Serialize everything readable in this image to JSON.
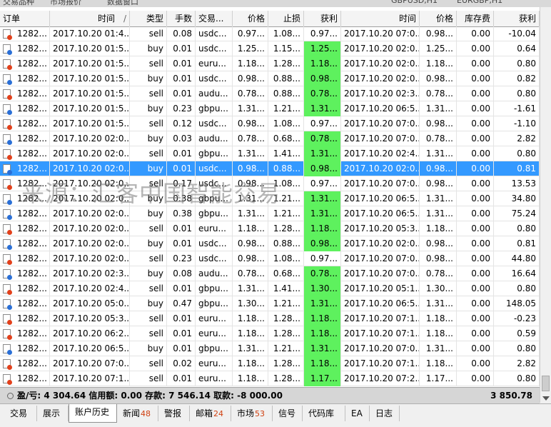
{
  "top_strip": {
    "titles": [
      "交易品种",
      "市场报价",
      "数据窗口",
      "GBPUSD,H1",
      "EURGBP,H1"
    ]
  },
  "headers": [
    "订单",
    "时间",
    "类型",
    "手数",
    "交易...",
    "价格",
    "止损",
    "获利",
    "时间",
    "价格",
    "库存费",
    "获利"
  ],
  "sort_indicator": "/",
  "rows": [
    {
      "order": "1282...",
      "open_time": "2017.10.20 01:4...",
      "type": "sell",
      "lots": "0.08",
      "symbol": "usdc...",
      "price": "0.97...",
      "sl": "1.08...",
      "tp": "0.97...",
      "tp_hit": false,
      "close_time": "2017.10.20 07:0...",
      "close_price": "0.98...",
      "swap": "0.00",
      "profit": "-10.04"
    },
    {
      "order": "1282...",
      "open_time": "2017.10.20 01:5...",
      "type": "buy",
      "lots": "0.01",
      "symbol": "usdc...",
      "price": "1.25...",
      "sl": "1.15...",
      "tp": "1.25...",
      "tp_hit": true,
      "close_time": "2017.10.20 02:0...",
      "close_price": "1.25...",
      "swap": "0.00",
      "profit": "0.64"
    },
    {
      "order": "1282...",
      "open_time": "2017.10.20 01:5...",
      "type": "sell",
      "lots": "0.01",
      "symbol": "euru...",
      "price": "1.18...",
      "sl": "1.28...",
      "tp": "1.18...",
      "tp_hit": true,
      "close_time": "2017.10.20 02:0...",
      "close_price": "1.18...",
      "swap": "0.00",
      "profit": "0.80"
    },
    {
      "order": "1282...",
      "open_time": "2017.10.20 01:5...",
      "type": "buy",
      "lots": "0.01",
      "symbol": "usdc...",
      "price": "0.98...",
      "sl": "0.88...",
      "tp": "0.98...",
      "tp_hit": true,
      "close_time": "2017.10.20 02:0...",
      "close_price": "0.98...",
      "swap": "0.00",
      "profit": "0.82"
    },
    {
      "order": "1282...",
      "open_time": "2017.10.20 01:5...",
      "type": "sell",
      "lots": "0.01",
      "symbol": "audu...",
      "price": "0.78...",
      "sl": "0.88...",
      "tp": "0.78...",
      "tp_hit": true,
      "close_time": "2017.10.20 02:3...",
      "close_price": "0.78...",
      "swap": "0.00",
      "profit": "0.80"
    },
    {
      "order": "1282...",
      "open_time": "2017.10.20 01:5...",
      "type": "buy",
      "lots": "0.23",
      "symbol": "gbpu...",
      "price": "1.31...",
      "sl": "1.21...",
      "tp": "1.31...",
      "tp_hit": true,
      "close_time": "2017.10.20 06:5...",
      "close_price": "1.31...",
      "swap": "0.00",
      "profit": "-1.61"
    },
    {
      "order": "1282...",
      "open_time": "2017.10.20 01:5...",
      "type": "sell",
      "lots": "0.12",
      "symbol": "usdc...",
      "price": "0.98...",
      "sl": "1.08...",
      "tp": "0.97...",
      "tp_hit": false,
      "close_time": "2017.10.20 07:0...",
      "close_price": "0.98...",
      "swap": "0.00",
      "profit": "-1.10"
    },
    {
      "order": "1282...",
      "open_time": "2017.10.20 02:0...",
      "type": "buy",
      "lots": "0.03",
      "symbol": "audu...",
      "price": "0.78...",
      "sl": "0.68...",
      "tp": "0.78...",
      "tp_hit": true,
      "close_time": "2017.10.20 07:0...",
      "close_price": "0.78...",
      "swap": "0.00",
      "profit": "2.82"
    },
    {
      "order": "1282...",
      "open_time": "2017.10.20 02:0...",
      "type": "sell",
      "lots": "0.01",
      "symbol": "gbpu...",
      "price": "1.31...",
      "sl": "1.41...",
      "tp": "1.31...",
      "tp_hit": true,
      "close_time": "2017.10.20 02:4...",
      "close_price": "1.31...",
      "swap": "0.00",
      "profit": "0.80"
    },
    {
      "order": "1282...",
      "open_time": "2017.10.20 02:0...",
      "type": "buy",
      "lots": "0.01",
      "symbol": "usdc...",
      "price": "0.98...",
      "sl": "0.88...",
      "tp": "0.98...",
      "tp_hit": true,
      "close_time": "2017.10.20 02:0...",
      "close_price": "0.98...",
      "swap": "0.00",
      "profit": "0.81",
      "selected": true
    },
    {
      "order": "1282...",
      "open_time": "2017.10.20 02:0...",
      "type": "sell",
      "lots": "0.17",
      "symbol": "usdc...",
      "price": "0.98...",
      "sl": "1.08...",
      "tp": "0.97...",
      "tp_hit": false,
      "close_time": "2017.10.20 07:0...",
      "close_price": "0.98...",
      "swap": "0.00",
      "profit": "13.53"
    },
    {
      "order": "1282...",
      "open_time": "2017.10.20 02:0...",
      "type": "buy",
      "lots": "0.38",
      "symbol": "gbpu...",
      "price": "1.31...",
      "sl": "1.21...",
      "tp": "1.31...",
      "tp_hit": true,
      "close_time": "2017.10.20 06:5...",
      "close_price": "1.31...",
      "swap": "0.00",
      "profit": "34.80"
    },
    {
      "order": "1282...",
      "open_time": "2017.10.20 02:0...",
      "type": "buy",
      "lots": "0.38",
      "symbol": "gbpu...",
      "price": "1.31...",
      "sl": "1.21...",
      "tp": "1.31...",
      "tp_hit": true,
      "close_time": "2017.10.20 06:5...",
      "close_price": "1.31...",
      "swap": "0.00",
      "profit": "75.24"
    },
    {
      "order": "1282...",
      "open_time": "2017.10.20 02:0...",
      "type": "sell",
      "lots": "0.01",
      "symbol": "euru...",
      "price": "1.18...",
      "sl": "1.28...",
      "tp": "1.18...",
      "tp_hit": true,
      "close_time": "2017.10.20 05:3...",
      "close_price": "1.18...",
      "swap": "0.00",
      "profit": "0.80"
    },
    {
      "order": "1282...",
      "open_time": "2017.10.20 02:0...",
      "type": "buy",
      "lots": "0.01",
      "symbol": "usdc...",
      "price": "0.98...",
      "sl": "0.88...",
      "tp": "0.98...",
      "tp_hit": true,
      "close_time": "2017.10.20 02:0...",
      "close_price": "0.98...",
      "swap": "0.00",
      "profit": "0.81"
    },
    {
      "order": "1282...",
      "open_time": "2017.10.20 02:0...",
      "type": "sell",
      "lots": "0.23",
      "symbol": "usdc...",
      "price": "0.98...",
      "sl": "1.08...",
      "tp": "0.97...",
      "tp_hit": false,
      "close_time": "2017.10.20 07:0...",
      "close_price": "0.98...",
      "swap": "0.00",
      "profit": "44.80"
    },
    {
      "order": "1282...",
      "open_time": "2017.10.20 02:3...",
      "type": "buy",
      "lots": "0.08",
      "symbol": "audu...",
      "price": "0.78...",
      "sl": "0.68...",
      "tp": "0.78...",
      "tp_hit": true,
      "close_time": "2017.10.20 07:0...",
      "close_price": "0.78...",
      "swap": "0.00",
      "profit": "16.64"
    },
    {
      "order": "1282...",
      "open_time": "2017.10.20 02:4...",
      "type": "sell",
      "lots": "0.01",
      "symbol": "gbpu...",
      "price": "1.31...",
      "sl": "1.41...",
      "tp": "1.30...",
      "tp_hit": true,
      "close_time": "2017.10.20 05:1...",
      "close_price": "1.30...",
      "swap": "0.00",
      "profit": "0.80"
    },
    {
      "order": "1282...",
      "open_time": "2017.10.20 05:0...",
      "type": "buy",
      "lots": "0.47",
      "symbol": "gbpu...",
      "price": "1.30...",
      "sl": "1.21...",
      "tp": "1.31...",
      "tp_hit": true,
      "close_time": "2017.10.20 06:5...",
      "close_price": "1.31...",
      "swap": "0.00",
      "profit": "148.05"
    },
    {
      "order": "1282...",
      "open_time": "2017.10.20 05:3...",
      "type": "sell",
      "lots": "0.01",
      "symbol": "euru...",
      "price": "1.18...",
      "sl": "1.28...",
      "tp": "1.18...",
      "tp_hit": true,
      "close_time": "2017.10.20 07:1...",
      "close_price": "1.18...",
      "swap": "0.00",
      "profit": "-0.23"
    },
    {
      "order": "1282...",
      "open_time": "2017.10.20 06:2...",
      "type": "sell",
      "lots": "0.01",
      "symbol": "euru...",
      "price": "1.18...",
      "sl": "1.28...",
      "tp": "1.18...",
      "tp_hit": true,
      "close_time": "2017.10.20 07:1...",
      "close_price": "1.18...",
      "swap": "0.00",
      "profit": "0.59"
    },
    {
      "order": "1282...",
      "open_time": "2017.10.20 06:5...",
      "type": "buy",
      "lots": "0.01",
      "symbol": "gbpu...",
      "price": "1.31...",
      "sl": "1.21...",
      "tp": "1.31...",
      "tp_hit": true,
      "close_time": "2017.10.20 07:0...",
      "close_price": "1.31...",
      "swap": "0.00",
      "profit": "0.80"
    },
    {
      "order": "1282...",
      "open_time": "2017.10.20 07:0...",
      "type": "sell",
      "lots": "0.02",
      "symbol": "euru...",
      "price": "1.18...",
      "sl": "1.28...",
      "tp": "1.18...",
      "tp_hit": true,
      "close_time": "2017.10.20 07:1...",
      "close_price": "1.18...",
      "swap": "0.00",
      "profit": "2.82"
    },
    {
      "order": "1282...",
      "open_time": "2017.10.20 07:1...",
      "type": "sell",
      "lots": "0.01",
      "symbol": "euru...",
      "price": "1.18...",
      "sl": "1.28...",
      "tp": "1.17...",
      "tp_hit": true,
      "close_time": "2017.10.20 07:2...",
      "close_price": "1.17...",
      "swap": "0.00",
      "profit": "0.80"
    }
  ],
  "watermark": "来源：汇客中国智能交易",
  "summary": {
    "text": "盈/亏: 4 304.64  信用额: 0.00  存款: 7 546.14  取款: -8 000.00",
    "total": "3 850.78"
  },
  "tabs": [
    {
      "label": "交易",
      "count": ""
    },
    {
      "label": "展示",
      "count": ""
    },
    {
      "label": "账户历史",
      "count": "",
      "active": true
    },
    {
      "label": "新闻",
      "count": "48"
    },
    {
      "label": "警报",
      "count": ""
    },
    {
      "label": "邮箱",
      "count": "24"
    },
    {
      "label": "市场",
      "count": "53"
    },
    {
      "label": "信号",
      "count": ""
    },
    {
      "label": "代码库",
      "count": ""
    },
    {
      "label": "EA",
      "count": ""
    },
    {
      "label": "日志",
      "count": ""
    }
  ],
  "colors": {
    "tp_hit": "#5ef15e",
    "selected_row": "#3399ff",
    "buy_icon": "#2a6fd6",
    "sell_icon": "#e2401b"
  }
}
